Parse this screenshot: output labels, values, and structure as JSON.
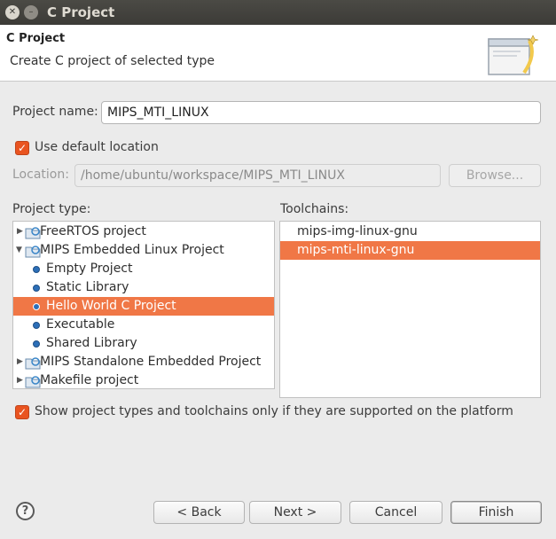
{
  "window": {
    "title": "C Project"
  },
  "banner": {
    "title": "C Project",
    "description": "Create C project of selected type"
  },
  "form": {
    "project_name_label": "Project name:",
    "project_name_value": "MIPS_MTI_LINUX",
    "use_default_location_label": "Use default location",
    "use_default_location_checked": true,
    "location_label": "Location:",
    "location_value": "/home/ubuntu/workspace/MIPS_MTI_LINUX",
    "browse_label": "Browse..."
  },
  "project_type": {
    "label": "Project type:",
    "items": [
      {
        "label": "FreeRTOS project",
        "kind": "folder",
        "expanded": false,
        "selected": false
      },
      {
        "label": "MIPS Embedded Linux Project",
        "kind": "folder",
        "expanded": true,
        "selected": false
      },
      {
        "label": "Empty Project",
        "kind": "item",
        "selected": false
      },
      {
        "label": "Static Library",
        "kind": "item",
        "selected": false
      },
      {
        "label": "Hello World C Project",
        "kind": "item",
        "selected": true
      },
      {
        "label": "Executable",
        "kind": "item",
        "selected": false
      },
      {
        "label": "Shared Library",
        "kind": "item",
        "selected": false
      },
      {
        "label": "MIPS Standalone Embedded Project",
        "kind": "folder",
        "expanded": false,
        "selected": false
      },
      {
        "label": "Makefile project",
        "kind": "folder",
        "expanded": false,
        "selected": false
      }
    ]
  },
  "toolchains": {
    "label": "Toolchains:",
    "items": [
      {
        "label": "mips-img-linux-gnu",
        "selected": false
      },
      {
        "label": "mips-mti-linux-gnu",
        "selected": true
      }
    ]
  },
  "filter": {
    "label": "Show project types and toolchains only if they are supported on the platform",
    "checked": true
  },
  "buttons": {
    "help": "?",
    "back": "< Back",
    "next": "Next >",
    "cancel": "Cancel",
    "finish": "Finish"
  },
  "colors": {
    "accent": "#e95420",
    "selection": "#f07746",
    "titlebar": "#3c3b37"
  }
}
